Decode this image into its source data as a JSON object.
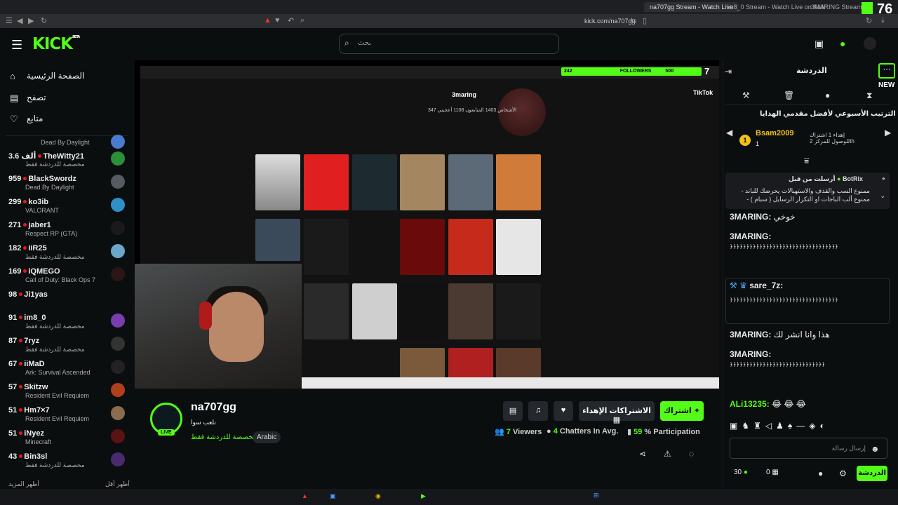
{
  "browser": {
    "tabs": [
      "na707gg Stream - Watch Live",
      "im8_0 Stream - Watch Live on Kick",
      "3MARING Stream - Watch"
    ],
    "url": "kick.com/na707gg",
    "overlay_count": "76"
  },
  "header": {
    "logo": "KICK",
    "logo_sup": "BETA",
    "search_placeholder": "بحث"
  },
  "nav": [
    {
      "label": "الصفحة الرئيسية",
      "icon": "home-icon"
    },
    {
      "label": "تصفح",
      "icon": "browse-icon"
    },
    {
      "label": "متابع",
      "icon": "heart-icon"
    }
  ],
  "channels": [
    {
      "viewers": "",
      "name": "",
      "category": "Dead By Daylight",
      "color": "#4b7bd1"
    },
    {
      "viewers": "3.6 ألف",
      "name": "TheWitty21",
      "category": "مخصصة للدردشة فقط",
      "color": "#2c8f3a"
    },
    {
      "viewers": "959",
      "name": "BlackSwordz",
      "category": "Dead By Daylight",
      "color": "#555b63"
    },
    {
      "viewers": "299",
      "name": "ko3ib",
      "category": "VALORANT",
      "color": "#2f8fc7"
    },
    {
      "viewers": "271",
      "name": "jaber1",
      "category": "Respect RP (GTA)",
      "color": "#1a1a1a"
    },
    {
      "viewers": "182",
      "name": "iiR25",
      "category": "مخصصة للدردشة فقط",
      "color": "#6aa7c8"
    },
    {
      "viewers": "169",
      "name": "iQMEGO",
      "category": "Call of Duty: Black Ops 7",
      "color": "#2a1616"
    },
    {
      "viewers": "98",
      "name": "Ji1yas",
      "category": "",
      "color": "#444"
    },
    {
      "viewers": "91",
      "name": "im8_0",
      "category": "مخصصة للدردشة فقط",
      "color": "#7a3db0"
    },
    {
      "viewers": "87",
      "name": "7ryz",
      "category": "مخصصة للدردشة فقط",
      "color": "#333"
    },
    {
      "viewers": "67",
      "name": "iiMaD",
      "category": "Ark: Survival Ascended",
      "color": "#222"
    },
    {
      "viewers": "57",
      "name": "Skitzw",
      "category": "Resident Evil Requiem",
      "color": "#b0401c"
    },
    {
      "viewers": "51",
      "name": "Hm7×7",
      "category": "Resident Evil Requiem",
      "color": "#8a6d4e"
    },
    {
      "viewers": "51",
      "name": "iNyez",
      "category": "Minecraft",
      "color": "#5a1212"
    },
    {
      "viewers": "43",
      "name": "Bin3sl",
      "category": "مخصصة للدردشة فقط",
      "color": "#4a2a6e"
    }
  ],
  "sidebar_footer": {
    "show_more": "أظهر المزيد",
    "show_less": "أظهر أقل"
  },
  "stream_overlay": {
    "followers_label": "FOLLOWERS",
    "followers_value": "242",
    "followers_goal": "500",
    "overlay_k": "7",
    "tiktok_label": "TikTok",
    "profile_name": "3maring",
    "profile_stats": "347 الأشخاص 1403 المتابعون 1108 أعجبني"
  },
  "channel": {
    "name": "na707gg",
    "title": "نلعب سوا",
    "category": "مخصصة للدردشة فقط",
    "tag": "Arabic",
    "live_badge": "LIVE",
    "subscribe_label": "اشتراك",
    "gift_label": "الاشتراكات الإهداء",
    "viewers_num": "7",
    "viewers_label": "Viewers",
    "chatters_num": "4",
    "chatters_label": "Chatters In Avg.",
    "participation_num": "59",
    "participation_label": "% Participation"
  },
  "chat": {
    "title": "الدردشة",
    "new_label": "NEW",
    "weekly_title": "الترتيب الأسبوعي لأفضل مقدمي الهدايا",
    "top_gifter": "Bsam2009",
    "top_gifter_rank": "1",
    "top_gifter_count": "1",
    "gifter_hint": "إهداء 1 اشتراك للوصول للمركز 2th",
    "pinned_by": "أرسلت من قبل",
    "pinned_user": "BotRix",
    "pinned_text": "ممنوع السب والقذف والاستهبالات يحرضك للباند - ممنوع ألب الباجات او التكرار الرسايل ( سبام ) - ممنوع نشر...",
    "messages": [
      {
        "user": "3MARING:",
        "text": "خوخي"
      },
      {
        "user": "3MARING:",
        "text": "﴿﴿﴿﴿﴿﴿﴿﴿﴿﴿﴿﴿﴿﴿﴿﴿﴿﴿﴿﴿﴿﴿﴿﴿﴿﴿﴿﴿﴿﴿﴿﴿﴿"
      },
      {
        "user": "sare_7z:",
        "text": "﴿﴿﴿﴿﴿﴿﴿﴿﴿﴿﴿﴿﴿﴿﴿﴿﴿﴿﴿﴿﴿﴿﴿﴿﴿﴿﴿﴿﴿﴿﴿﴿﴿"
      },
      {
        "user": "3MARING:",
        "text": "هذا وانا انشر لك"
      },
      {
        "user": "3MARING:",
        "text": "﴿﴿﴿﴿﴿﴿﴿﴿﴿﴿﴿﴿﴿﴿﴿﴿﴿﴿﴿﴿﴿﴿﴿﴿﴿﴿﴿﴿﴿"
      },
      {
        "user": "ALi13235:",
        "text": "😂 😂 😂"
      }
    ],
    "input_placeholder": "إرسال رسالة",
    "points": "30",
    "gifts": "0",
    "send_label": "الدردشة"
  },
  "colors": {
    "accent": "#53fc18",
    "background": "#0b0e0f",
    "panel": "#24272c"
  }
}
